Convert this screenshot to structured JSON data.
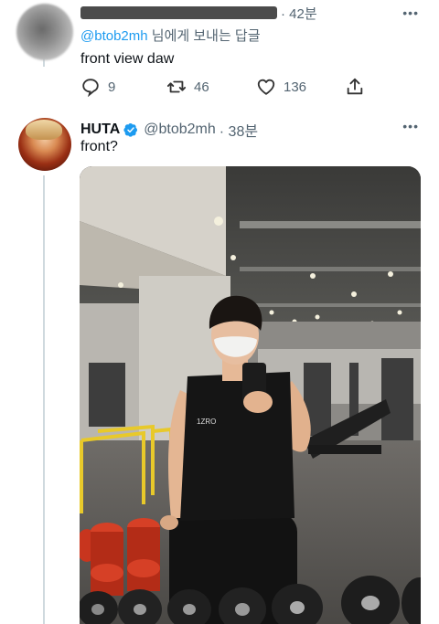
{
  "reply_tweet": {
    "time": "· 42분",
    "more": "•••",
    "replying_handle": "@btob2mh",
    "replying_suffix": " 님에게 보내는 답글",
    "text": "front view daw",
    "counts": {
      "replies": "9",
      "retweets": "46",
      "likes": "136"
    }
  },
  "main_tweet": {
    "name": "HUTA",
    "handle": "@btob2mh",
    "time": "· 38분",
    "more": "•••",
    "text": "front?",
    "shirt_text": "1ZRO"
  },
  "colors": {
    "accent": "#1d9bf0",
    "secondary_text": "#536471",
    "thread_line": "#cfd9de"
  }
}
